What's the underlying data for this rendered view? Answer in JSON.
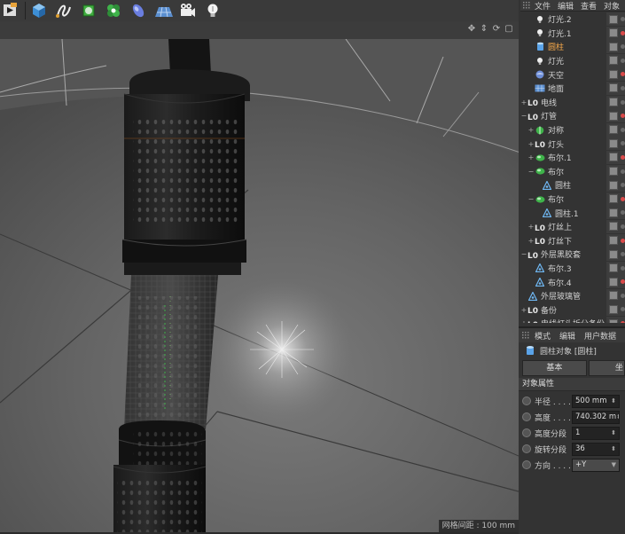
{
  "menu": {
    "items": [
      "文件",
      "编辑",
      "查看",
      "对象"
    ]
  },
  "toolbar": {
    "tools": [
      {
        "name": "render-icon"
      },
      {
        "name": "cube-icon"
      },
      {
        "name": "spline-icon"
      },
      {
        "name": "subdivision-icon"
      },
      {
        "name": "cloner-icon"
      },
      {
        "name": "deformer-icon"
      },
      {
        "name": "floor-icon"
      },
      {
        "name": "camera-icon"
      },
      {
        "name": "light-icon"
      }
    ]
  },
  "objects": [
    {
      "label": "灯光.2",
      "icon": "light-icon",
      "indent": 1,
      "highlight": false,
      "expander": ""
    },
    {
      "label": "灯光.1",
      "icon": "light-icon",
      "indent": 1,
      "highlight": false,
      "expander": ""
    },
    {
      "label": "圆柱",
      "icon": "cylinder-icon",
      "indent": 1,
      "highlight": true,
      "expander": ""
    },
    {
      "label": "灯光",
      "icon": "light-icon",
      "indent": 1,
      "highlight": false,
      "expander": ""
    },
    {
      "label": "天空",
      "icon": "sky-icon",
      "indent": 1,
      "highlight": false,
      "expander": ""
    },
    {
      "label": "地面",
      "icon": "floor-icon",
      "indent": 1,
      "highlight": false,
      "expander": ""
    },
    {
      "label": "电线",
      "icon": "null-icon",
      "indent": 0,
      "highlight": false,
      "expander": "+"
    },
    {
      "label": "灯管",
      "icon": "null-icon",
      "indent": 0,
      "highlight": false,
      "expander": "−"
    },
    {
      "label": "对称",
      "icon": "symmetry-icon",
      "indent": 1,
      "highlight": false,
      "expander": "+"
    },
    {
      "label": "灯头",
      "icon": "null-icon",
      "indent": 1,
      "highlight": false,
      "expander": "+"
    },
    {
      "label": "布尔.1",
      "icon": "boole-icon",
      "indent": 1,
      "highlight": false,
      "expander": "+"
    },
    {
      "label": "布尔",
      "icon": "boole-icon",
      "indent": 1,
      "highlight": false,
      "expander": "−"
    },
    {
      "label": "圆柱",
      "icon": "polygon-icon",
      "indent": 2,
      "highlight": false,
      "expander": ""
    },
    {
      "label": "布尔",
      "icon": "boole-icon",
      "indent": 1,
      "highlight": false,
      "expander": "−"
    },
    {
      "label": "圆柱.1",
      "icon": "polygon-icon",
      "indent": 2,
      "highlight": false,
      "expander": ""
    },
    {
      "label": "灯丝上",
      "icon": "null-icon",
      "indent": 1,
      "highlight": false,
      "expander": "+"
    },
    {
      "label": "灯丝下",
      "icon": "null-icon",
      "indent": 1,
      "highlight": false,
      "expander": "+"
    },
    {
      "label": "外层黑胶套",
      "icon": "null-icon",
      "indent": 0,
      "highlight": false,
      "expander": "−"
    },
    {
      "label": "布尔.3",
      "icon": "polygon-icon",
      "indent": 1,
      "highlight": false,
      "expander": ""
    },
    {
      "label": "布尔.4",
      "icon": "polygon-icon",
      "indent": 1,
      "highlight": false,
      "expander": ""
    },
    {
      "label": "外层玻璃管",
      "icon": "polygon-icon",
      "indent": 0,
      "highlight": false,
      "expander": ""
    },
    {
      "label": "备份",
      "icon": "null-icon",
      "indent": 0,
      "highlight": false,
      "expander": "+"
    },
    {
      "label": "电线灯头拆分备份",
      "icon": "null-icon",
      "indent": 0,
      "highlight": false,
      "expander": "+"
    }
  ],
  "attributes": {
    "menu": [
      "模式",
      "编辑",
      "用户数据"
    ],
    "title": "圆柱对象 [圆柱]",
    "tabs": [
      "基本",
      "坐标"
    ],
    "section": "对象属性",
    "props": [
      {
        "name": "半径 . . . .",
        "value": "500 mm",
        "type": "spinner"
      },
      {
        "name": "高度 . . . .",
        "value": "740.302 m",
        "type": "spinner"
      },
      {
        "name": "高度分段",
        "value": "1",
        "type": "spinner"
      },
      {
        "name": "旋转分段",
        "value": "36",
        "type": "spinner"
      },
      {
        "name": "方向 . . . .",
        "value": "+Y",
        "type": "dropdown"
      }
    ]
  },
  "viewport": {
    "status": "网格间距 : 100 mm",
    "nav_icons": [
      "move-view-icon",
      "zoom-view-icon",
      "rotate-view-icon",
      "maximize-view-icon"
    ]
  },
  "colors": {
    "highlight": "#f7a94a",
    "panel": "#333333",
    "viewport_bg": "#4d4d4d"
  }
}
